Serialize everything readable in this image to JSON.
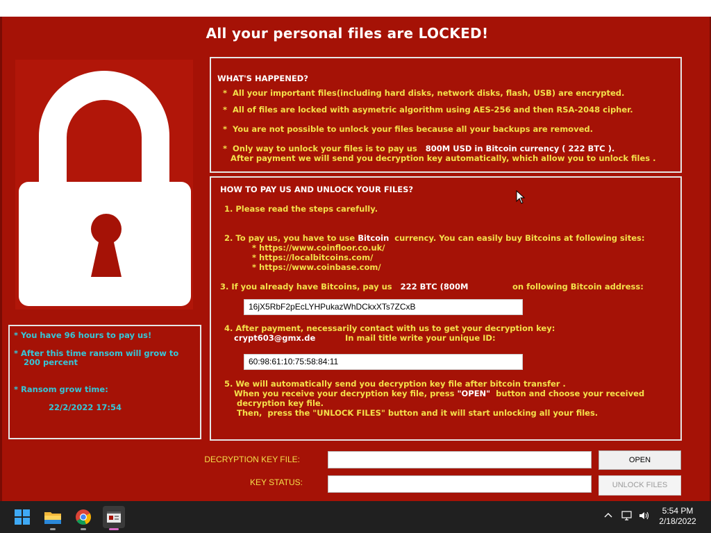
{
  "ransom_window": {
    "title": "All your personal files are LOCKED!",
    "timer": {
      "hours_line": "* You have 96 hours to pay us!",
      "grow_line1": "* After this time ransom will grow to",
      "grow_line2": "200 percent",
      "grow_time_label": "* Ransom grow time:",
      "grow_time_value": "22/2/2022 17:54"
    },
    "whats_happened": {
      "heading": "WHAT'S HAPPENED?",
      "line1": "*  All your important files(including hard disks, network disks, flash, USB) are encrypted.",
      "line2": "*  All of files are locked with asymetric algorithm using AES-256 and then RSA-2048 cipher.",
      "line3": "*  You are not possible to unlock your files because all your backups are removed.",
      "line4a": "*  Only way to unlock your files is to pay us ",
      "line4_amount": "  800M USD in Bitcoin currency ( 222 BTC ).",
      "line4b": "After payment we will send you decryption key automatically, which allow you to unlock files ."
    },
    "how_to_pay": {
      "heading": "HOW TO PAY US AND UNLOCK YOUR FILES?",
      "step1": "1. Please read the steps carefully.",
      "step2a": "2. To pay us, you have to use ",
      "step2_word": "Bitcoin",
      "step2b": "  currency. You can easily buy Bitcoins at following sites:",
      "site1": "* https://www.coinfloor.co.uk/",
      "site2": "* https://localbitcoins.com/",
      "site3": "* https://www.coinbase.com/",
      "step3a": "3. If you already have Bitcoins, pay us ",
      "step3_amount": "  222 BTC (800M",
      "step3b": "on following Bitcoin address:",
      "btc_address": "16jX5RbF2pEcLYHPukazWhDCkxXTs7ZCxB",
      "step4a": "4. After payment, necessarily contact with us to get your decryption key:",
      "step4_email": "crypt603@gmx.de",
      "step4b": "In mail title write your unique ID:",
      "unique_id": "60:98:61:10:75:58:84:11",
      "step5a": "5. We will automatically send you decryption key file after bitcoin transfer .",
      "step5b": "When you receive your decryption key file, press ",
      "step5_open": "\"OPEN\"",
      "step5c": "  button and choose your received",
      "step5d": "decryption key file.",
      "step5e": "Then,  press the \"UNLOCK FILES\" button and it will start unlocking all your files."
    },
    "form": {
      "key_file_label": "DECRYPTION KEY FILE:",
      "key_status_label": "KEY STATUS:",
      "open_button": "OPEN",
      "unlock_button": "UNLOCK FILES"
    },
    "colors": {
      "background": "#a51206",
      "text_yellow": "#f4e04a",
      "text_cyan": "#35c7d8",
      "border": "#e6e6e6"
    }
  },
  "taskbar": {
    "icons": [
      "windows-start-icon",
      "file-explorer-icon",
      "chrome-icon",
      "ransom-app-icon"
    ],
    "tray_icons": [
      "chevron-up-icon",
      "network-icon",
      "volume-icon"
    ],
    "time": "5:54 PM",
    "date": "2/18/2022"
  }
}
